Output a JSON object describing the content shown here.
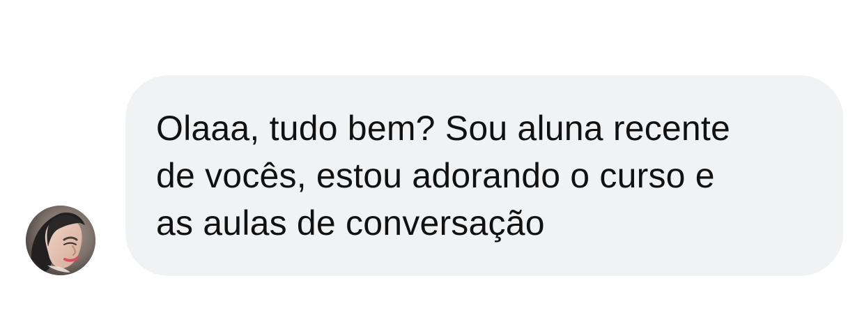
{
  "conversation": {
    "sender": {
      "avatar_icon": "profile-photo"
    },
    "message": {
      "lines": [
        "Olaaa, tudo bem? Sou aluna recente",
        "de vocês, estou adorando o curso e",
        "as aulas de conversação"
      ]
    }
  },
  "colors": {
    "page_background": "#ffffff",
    "bubble_background": "#f1f2f4",
    "message_text": "#111111"
  }
}
